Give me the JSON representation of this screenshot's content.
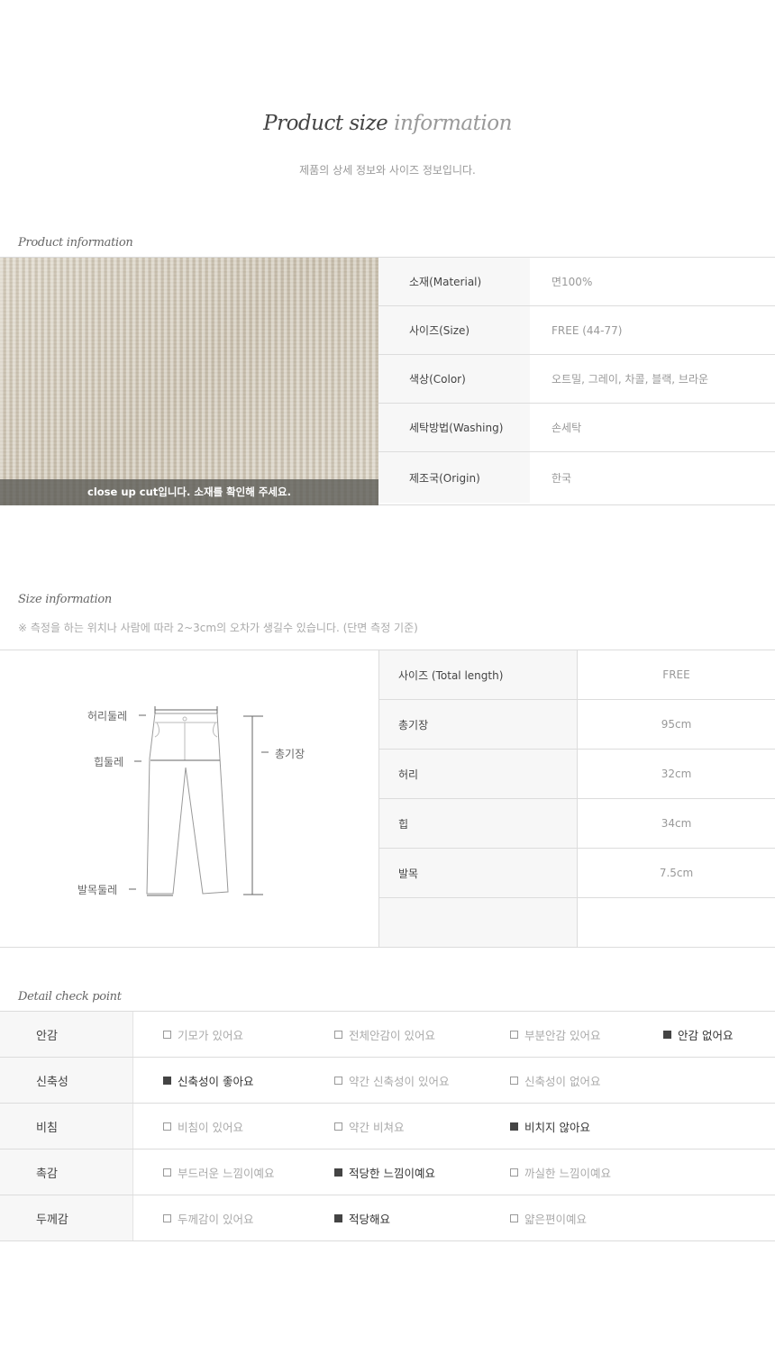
{
  "header": {
    "title_main": "Product size",
    "title_accent": "information",
    "subtitle": "제품의 상세 정보와 사이즈 정보입니다."
  },
  "product_info": {
    "section_title": "Product information",
    "photo_caption": "close up cut입니다. 소재를 확인해 주세요.",
    "rows": [
      {
        "label": "소재(Material)",
        "value": "면100%"
      },
      {
        "label": "사이즈(Size)",
        "value": "FREE (44-77)"
      },
      {
        "label": "색상(Color)",
        "value": "오트밀, 그레이, 차콜, 블랙, 브라운"
      },
      {
        "label": "세탁방법(Washing)",
        "value": "손세탁"
      },
      {
        "label": "제조국(Origin)",
        "value": "한국"
      }
    ]
  },
  "size_info": {
    "section_title": "Size information",
    "note": "※ 측정을 하는 위치나 사람에 따라 2~3cm의 오차가 생길수 있습니다. (단면 측정 기준)",
    "diagram_labels": {
      "waist": "허리둘레",
      "hip": "힙둘레",
      "ankle": "발목둘레",
      "total_length": "총기장"
    },
    "rows": [
      {
        "label": "사이즈 (Total length)",
        "value": "FREE"
      },
      {
        "label": "총기장",
        "value": "95cm"
      },
      {
        "label": "허리",
        "value": "32cm"
      },
      {
        "label": "힙",
        "value": "34cm"
      },
      {
        "label": "발목",
        "value": "7.5cm"
      },
      {
        "label": "",
        "value": ""
      }
    ]
  },
  "detail_check": {
    "section_title": "Detail check point",
    "rows": [
      {
        "label": "안감",
        "options": [
          {
            "text": "기모가 있어요",
            "checked": false
          },
          {
            "text": "전체안감이 있어요",
            "checked": false
          },
          {
            "text": "부분안감 있어요",
            "checked": false
          },
          {
            "text": "안감 없어요",
            "checked": true
          }
        ]
      },
      {
        "label": "신축성",
        "options": [
          {
            "text": "신축성이 좋아요",
            "checked": true
          },
          {
            "text": "약간 신축성이 있어요",
            "checked": false
          },
          {
            "text": "신축성이 없어요",
            "checked": false
          }
        ]
      },
      {
        "label": "비침",
        "options": [
          {
            "text": "비침이 있어요",
            "checked": false
          },
          {
            "text": "약간 비쳐요",
            "checked": false
          },
          {
            "text": "비치지 않아요",
            "checked": true
          }
        ]
      },
      {
        "label": "촉감",
        "options": [
          {
            "text": "부드러운 느낌이예요",
            "checked": false
          },
          {
            "text": "적당한 느낌이예요",
            "checked": true
          },
          {
            "text": "까실한 느낌이예요",
            "checked": false
          }
        ]
      },
      {
        "label": "두께감",
        "options": [
          {
            "text": "두께감이 있어요",
            "checked": false
          },
          {
            "text": "적당해요",
            "checked": true
          },
          {
            "text": "얇은편이예요",
            "checked": false
          }
        ]
      }
    ]
  }
}
